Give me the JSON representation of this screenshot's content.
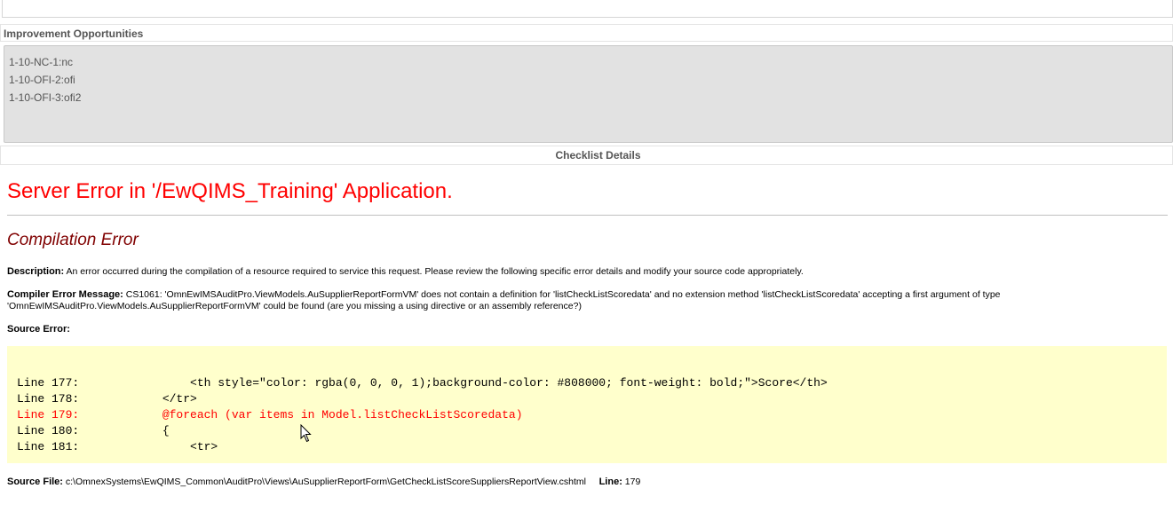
{
  "improvement_opportunities": {
    "title": "Improvement Opportunities",
    "items": [
      "1-10-NC-1:nc",
      "1-10-OFI-2:ofi",
      "1-10-OFI-3:ofi2"
    ]
  },
  "checklist_details": {
    "label": "Checklist Details"
  },
  "error": {
    "title": "Server Error in '/EwQIMS_Training' Application.",
    "subtitle": "Compilation Error",
    "description_label": "Description:",
    "description_text": "An error occurred during the compilation of a resource required to service this request. Please review the following specific error details and modify your source code appropriately.",
    "compiler_label": "Compiler Error Message:",
    "compiler_text": "CS1061: 'OmnEwIMSAuditPro.ViewModels.AuSupplierReportFormVM' does not contain a definition for 'listCheckListScoredata' and no extension method 'listCheckListScoredata' accepting a first argument of type 'OmnEwIMSAuditPro.ViewModels.AuSupplierReportFormVM' could be found (are you missing a using directive or an assembly reference?)",
    "source_error_label": "Source Error:",
    "code_lines": [
      "Line 177:                <th style=\"color: rgba(0, 0, 0, 1);background-color: #808000; font-weight: bold;\">Score</th>",
      "Line 178:            </tr>",
      "Line 179:            @foreach (var items in Model.listCheckListScoredata)",
      "Line 180:            {",
      "Line 181:                <tr>"
    ],
    "highlight_line": 179,
    "source_file_label": "Source File:",
    "source_file_path": "c:\\OmnexSystems\\EwQIMS_Common\\AuditPro\\Views\\AuSupplierReportForm\\GetCheckListScoreSuppliersReportView.cshtml",
    "line_label": "Line:",
    "line_value": "179"
  },
  "colors": {
    "error_title": "#ff0000",
    "error_subtitle": "#800000",
    "code_background": "#ffffcc",
    "highlight_line": "#ff0000",
    "io_background": "#e2e2e2"
  }
}
